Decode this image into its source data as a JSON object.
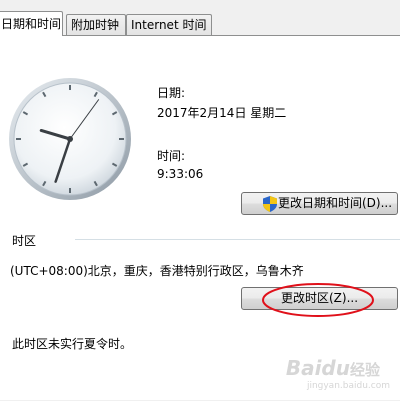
{
  "tabs": [
    {
      "label": "日期和时间"
    },
    {
      "label": "附加时钟"
    },
    {
      "label": "Internet 时间"
    }
  ],
  "clock": {
    "time": "9:33:06"
  },
  "date_section": {
    "date_label": "日期:",
    "date_value": "2017年2月14日 星期二",
    "time_label": "时间:",
    "time_value": "9:33:06"
  },
  "buttons": {
    "change_datetime": "更改日期和时间(D)...",
    "change_timezone": "更改时区(Z)..."
  },
  "timezone": {
    "header": "时区",
    "value": "(UTC+08:00)北京，重庆，香港特别行政区，乌鲁木齐",
    "dst_note": "此时区未实行夏令时。"
  },
  "watermark": {
    "brand": "Baidu",
    "sub": "经验",
    "url": "jingyan.baidu.com"
  }
}
